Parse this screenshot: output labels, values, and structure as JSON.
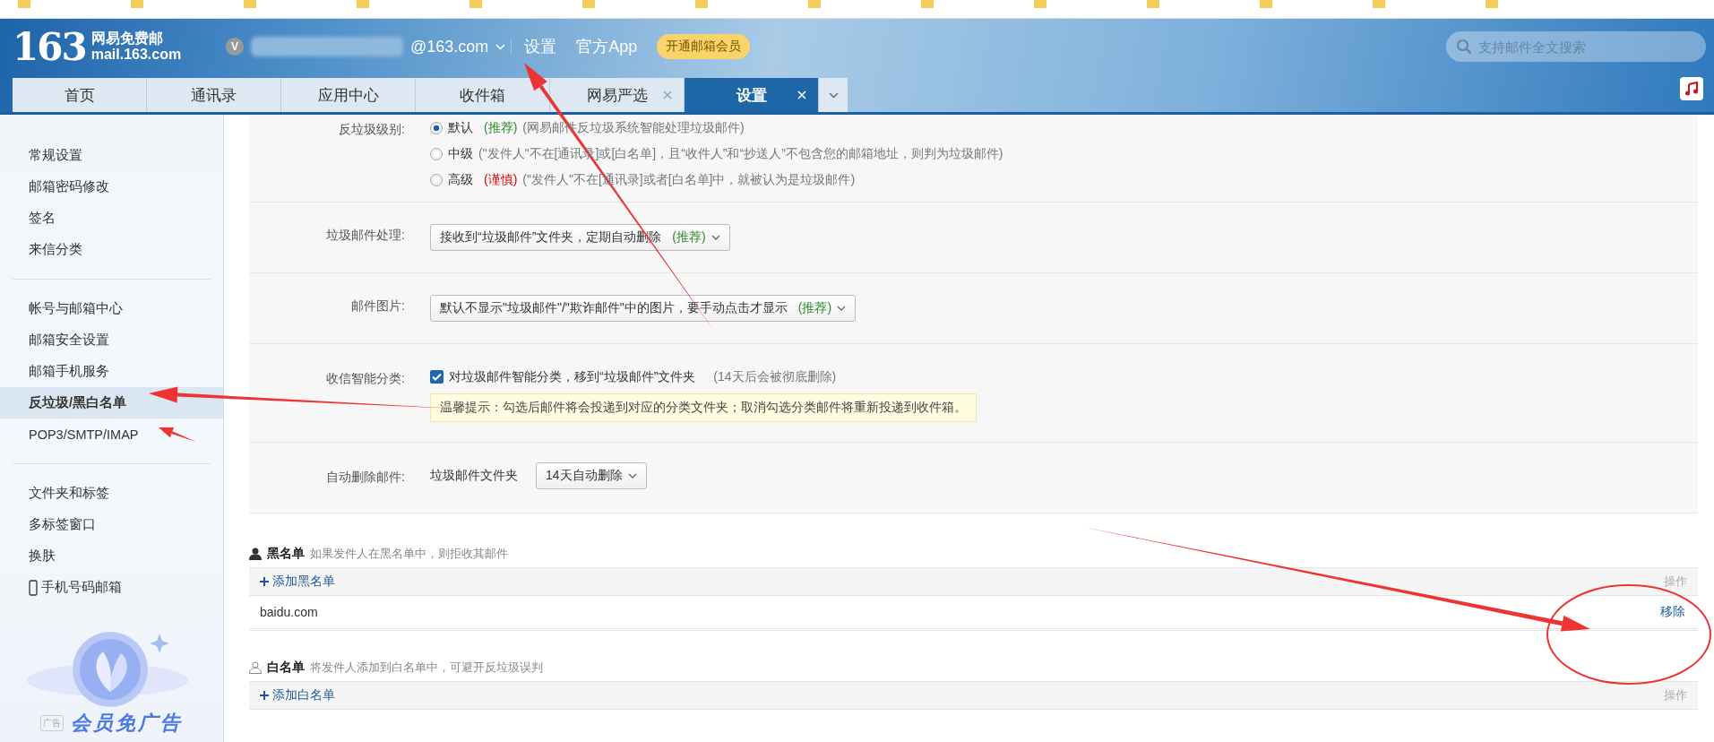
{
  "header": {
    "logo": {
      "number": "163",
      "name": "网易免费邮",
      "domain": "mail.163.com"
    },
    "account": {
      "badge": "V",
      "email": "@163.com"
    },
    "links": [
      "设置",
      "官方App"
    ],
    "vip_button": "开通邮箱会员",
    "search": {
      "placeholder": "支持邮件全文搜索"
    }
  },
  "tabs": [
    {
      "label": "首页",
      "selected": false,
      "closable": false
    },
    {
      "label": "通讯录",
      "selected": false,
      "closable": false
    },
    {
      "label": "应用中心",
      "selected": false,
      "closable": false
    },
    {
      "label": "收件箱",
      "selected": false,
      "closable": false
    },
    {
      "label": "网易严选",
      "selected": false,
      "closable": true
    },
    {
      "label": "设置",
      "selected": true,
      "closable": true
    }
  ],
  "sidebar": {
    "groups": [
      [
        {
          "label": "常规设置",
          "selected": false,
          "kind": "text"
        },
        {
          "label": "邮箱密码修改",
          "selected": false,
          "kind": "text"
        },
        {
          "label": "签名",
          "selected": false,
          "kind": "text"
        },
        {
          "label": "来信分类",
          "selected": false,
          "kind": "text"
        }
      ],
      [
        {
          "label": "帐号与邮箱中心",
          "selected": false,
          "kind": "text"
        },
        {
          "label": "邮箱安全设置",
          "selected": false,
          "kind": "text"
        },
        {
          "label": "邮箱手机服务",
          "selected": false,
          "kind": "text"
        },
        {
          "label": "反垃圾/黑白名单",
          "selected": true,
          "kind": "text"
        },
        {
          "label": "POP3/SMTP/IMAP",
          "selected": false,
          "kind": "text"
        }
      ],
      [
        {
          "label": "文件夹和标签",
          "selected": false,
          "kind": "text"
        },
        {
          "label": "多标签窗口",
          "selected": false,
          "kind": "text"
        },
        {
          "label": "换肤",
          "selected": false,
          "kind": "text"
        },
        {
          "label": "手机号码邮箱",
          "selected": false,
          "kind": "phone"
        }
      ]
    ],
    "ad": {
      "badge": "广告",
      "text": "会员免广告"
    }
  },
  "settings": [
    {
      "kind": "radio_group",
      "label": "反垃圾级别:",
      "options": [
        {
          "label": "默认",
          "tag": {
            "text": "(推荐)",
            "kind": "recommend"
          },
          "note": "(网易邮件反垃圾系统智能处理垃圾邮件)",
          "selected": true
        },
        {
          "label": "中级",
          "note": "(\"发件人\"不在[通讯录]或[白名单]，且“收件人”和“抄送人”不包含您的邮箱地址，则判为垃圾邮件)",
          "selected": false
        },
        {
          "label": "高级",
          "tag": {
            "text": "(谨慎)",
            "kind": "caution"
          },
          "note": "(\"发件人\"不在[通讯录]或者[白名单]中，就被认为是垃圾邮件)",
          "selected": false
        }
      ]
    },
    {
      "kind": "select",
      "label": "垃圾邮件处理:",
      "value": "接收到“垃圾邮件”文件夹，定期自动删除",
      "tag": {
        "text": "(推荐)",
        "kind": "recommend"
      }
    },
    {
      "kind": "select",
      "label": "邮件图片:",
      "value": "默认不显示\"垃圾邮件\"/\"欺诈邮件\"中的图片，要手动点击才显示",
      "tag": {
        "text": "(推荐)",
        "kind": "recommend"
      }
    },
    {
      "kind": "checkbox",
      "label": "收信智能分类:",
      "text": "对垃圾邮件智能分类，移到“垃圾邮件”文件夹",
      "note": "(14天后会被彻底删除)",
      "checked": true,
      "tip": "温馨提示：勾选后邮件将会投递到对应的分类文件夹；取消勾选分类邮件将重新投递到收件箱。"
    },
    {
      "kind": "labeled_select",
      "label": "自动删除邮件:",
      "prefix": "垃圾邮件文件夹",
      "value": "14天自动删除"
    }
  ],
  "lists": [
    {
      "kind": "blacklist",
      "title": "黑名单",
      "hint": "如果发件人在黑名单中，则拒收其邮件",
      "add_label": "添加黑名单",
      "action_header": "操作",
      "rows": [
        {
          "address": "baidu.com",
          "action": "移除"
        }
      ]
    },
    {
      "kind": "whitelist",
      "title": "白名单",
      "hint": "将发件人添加到白名单中，可避开反垃圾误判",
      "add_label": "添加白名单",
      "action_header": "操作"
    }
  ]
}
